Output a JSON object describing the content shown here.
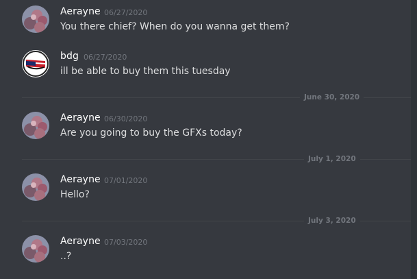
{
  "messages": [
    {
      "author": "Aerayne",
      "timestamp": "06/27/2020",
      "content": "You there chief? When do you wanna get them?"
    },
    {
      "author": "bdg",
      "timestamp": "06/27/2020",
      "content": "ill be able to buy them this tuesday"
    },
    {
      "author": "Aerayne",
      "timestamp": "06/30/2020",
      "content": "Are you going to buy the GFXs today?"
    },
    {
      "author": "Aerayne",
      "timestamp": "07/01/2020",
      "content": "Hello?"
    },
    {
      "author": "Aerayne",
      "timestamp": "07/03/2020",
      "content": "..?"
    }
  ],
  "dividers": [
    "June 30, 2020",
    "July 1, 2020",
    "July 3, 2020"
  ],
  "colors": {
    "background": "#36393f",
    "author": "#ffffff",
    "text": "#dcddde",
    "muted": "#72767d"
  },
  "icons": {
    "aerayne_avatar": "cherry-blossom-avatar-icon",
    "bdg_avatar": "flag-avatar-icon"
  }
}
